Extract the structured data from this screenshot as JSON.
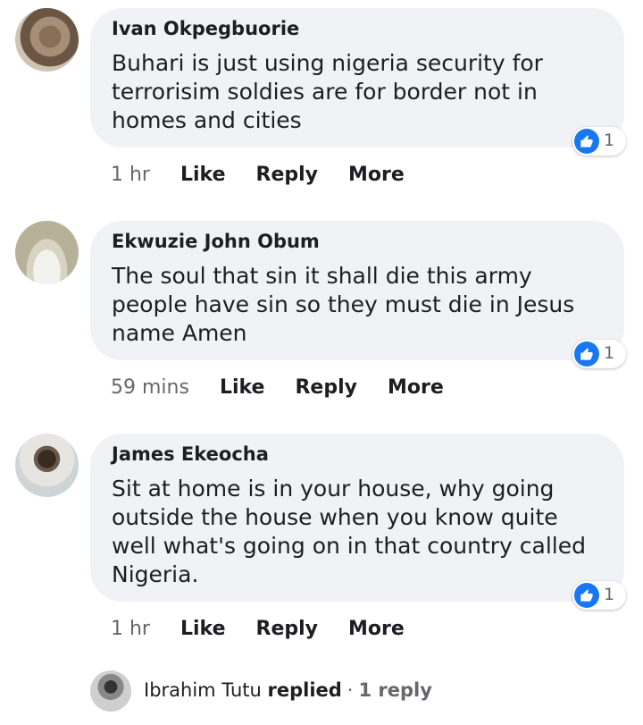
{
  "comments": [
    {
      "author": "Ivan Okpegbuorie",
      "text": "Buhari is just using nigeria security for terrorisim soldies are for border not in homes and cities",
      "likes": "1",
      "time": "1 hr",
      "like_label": "Like",
      "reply_label": "Reply",
      "more_label": "More"
    },
    {
      "author": "Ekwuzie John Obum",
      "text": "The soul that sin it shall die this army people have sin so they must die in Jesus name Amen",
      "likes": "1",
      "time": "59 mins",
      "like_label": "Like",
      "reply_label": "Reply",
      "more_label": "More"
    },
    {
      "author": "James Ekeocha",
      "text": "Sit at home is in your house, why going outside the house when you know quite well what's going on in that country called Nigeria.",
      "likes": "1",
      "time": "1 hr",
      "like_label": "Like",
      "reply_label": "Reply",
      "more_label": "More"
    }
  ],
  "reply_summary": {
    "name": "Ibrahim Tutu",
    "verb": "replied",
    "separator": "·",
    "count_label": "1 reply"
  },
  "colors": {
    "bubble": "#f0f2f5",
    "like_blue": "#1877f2",
    "meta_gray": "#65676b"
  },
  "icons": {
    "like_badge": "thumbs-up-icon"
  }
}
